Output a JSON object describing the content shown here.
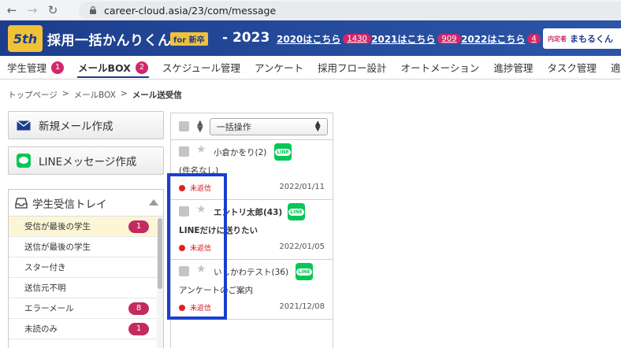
{
  "browser": {
    "url": "career-cloud.asia/23/com/message",
    "back_icon": "back-arrow-icon",
    "forward_icon": "forward-arrow-icon",
    "reload_icon": "reload-icon"
  },
  "header": {
    "logo_badge": "5th",
    "logo_text": "採用一括かんりくん",
    "logo_sub": "for 新卒",
    "logo_year": "- 2023",
    "year_links": [
      {
        "label": "2020はこちら",
        "count": "1430"
      },
      {
        "label": "2021はこちら",
        "count": "909"
      },
      {
        "label": "2022はこちら",
        "count": "4"
      }
    ],
    "mamoru_prefix": "内定者",
    "mamoru_label": "まもるくん"
  },
  "tabs": [
    {
      "label": "学生管理",
      "count": "1"
    },
    {
      "label": "メールBOX",
      "count": "2"
    },
    {
      "label": "スケジュール管理"
    },
    {
      "label": "アンケート"
    },
    {
      "label": "採用フロー設計"
    },
    {
      "label": "オートメーション"
    },
    {
      "label": "進捗管理"
    },
    {
      "label": "タスク管理"
    },
    {
      "label": "適"
    }
  ],
  "breadcrumb": {
    "items": [
      "トップページ",
      ">",
      "メールBOX",
      ">"
    ],
    "current": "メール送受信"
  },
  "actions": {
    "new_mail": "新規メール作成",
    "line_message": "LINEメッセージ作成"
  },
  "tray": {
    "title": "学生受信トレイ",
    "items": [
      {
        "label": "受信が最後の学生",
        "count": "1"
      },
      {
        "label": "送信が最後の学生"
      },
      {
        "label": "スター付き"
      },
      {
        "label": "送信元不明"
      },
      {
        "label": "エラーメール",
        "count": "8"
      },
      {
        "label": "未読のみ",
        "count": "1"
      }
    ]
  },
  "message_list": {
    "bulk_action": "一括操作",
    "messages": [
      {
        "sender": "小倉かをり(2)",
        "subject": "(件名なし)",
        "status": "未返信",
        "date": "2022/01/11",
        "line": "LINE"
      },
      {
        "sender": "エントリ太郎(43)",
        "subject": "LINEだけに送りたい",
        "status": "未返信",
        "date": "2022/01/05",
        "line": "LINE"
      },
      {
        "sender": "いしかわテスト(36)",
        "subject": "アンケートのご案内",
        "status": "未返信",
        "date": "2021/12/08",
        "line": "LINE"
      }
    ]
  },
  "colors": {
    "brand_blue": "#1d3d8c",
    "badge_pink": "#d3266a",
    "line_green": "#06c755",
    "highlight_blue": "#1a3fd1",
    "unreplied_red": "#e02020"
  }
}
